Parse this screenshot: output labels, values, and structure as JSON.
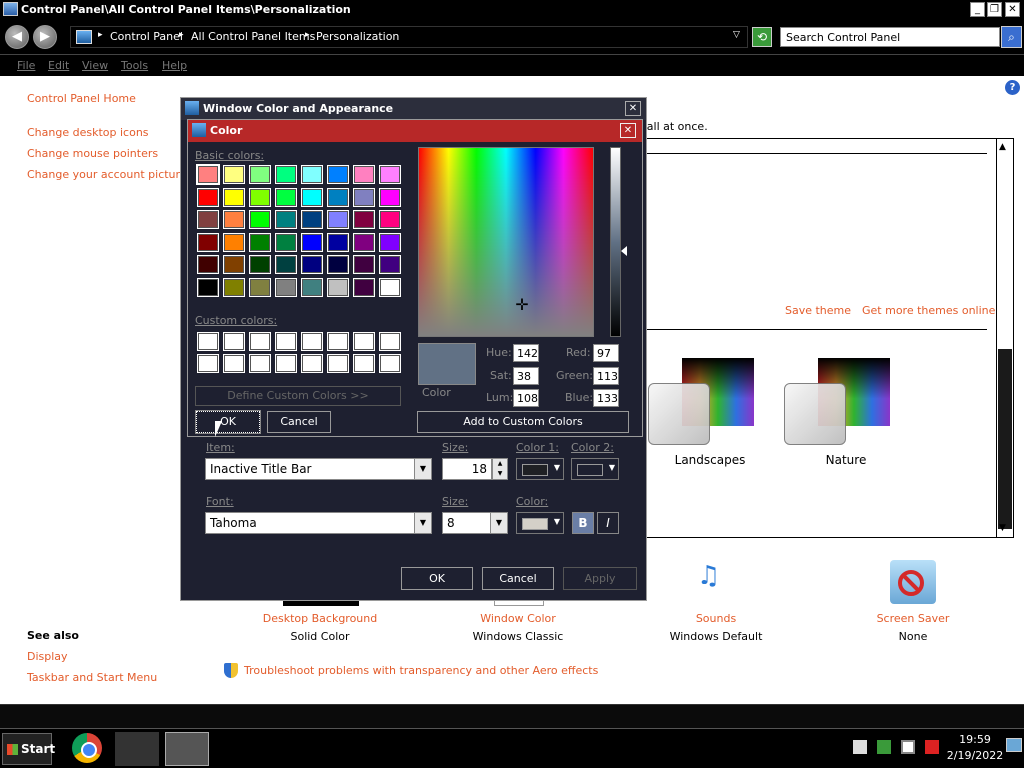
{
  "window": {
    "title": "Control Panel\\All Control Panel Items\\Personalization",
    "minimize_glyph": "_",
    "maximize_glyph": "❐",
    "close_glyph": "✕"
  },
  "address": {
    "back_glyph": "◀",
    "forward_glyph": "▶",
    "crumbs": [
      "Control Panel",
      "All Control Panel Items",
      "Personalization"
    ],
    "search_placeholder": "Search Control Panel"
  },
  "menu": [
    "File",
    "Edit",
    "View",
    "Tools",
    "Help"
  ],
  "sidebar": {
    "home": "Control Panel Home",
    "links": [
      "Change desktop icons",
      "Change mouse pointers",
      "Change your account picture"
    ],
    "see_also_title": "See also",
    "see_also": [
      "Display",
      "Taskbar and Start Menu"
    ]
  },
  "themes": {
    "description_fragment": "er all at once.",
    "save_theme": "Save theme",
    "get_more": "Get more themes online",
    "items": [
      "Landscapes",
      "Nature"
    ]
  },
  "bottom": [
    {
      "title": "Desktop Background",
      "sub": "Solid Color"
    },
    {
      "title": "Window Color",
      "sub": "Windows Classic"
    },
    {
      "title": "Sounds",
      "sub": "Windows Default"
    },
    {
      "title": "Screen Saver",
      "sub": "None"
    }
  ],
  "troubleshoot": "Troubleshoot problems with transparency and other Aero effects",
  "wca": {
    "title": "Window Color and Appearance",
    "item_label": "Item:",
    "item_value": "Inactive Title Bar",
    "size_label": "Size:",
    "item_size": "18",
    "color1_label": "Color 1:",
    "color2_label": "Color 2:",
    "color1": "#1f2024",
    "color2": "#1e2030",
    "font_label": "Font:",
    "font_value": "Tahoma",
    "font_size_label": "Size:",
    "font_size": "8",
    "font_color_label": "Color:",
    "font_color": "#d4d0c8",
    "bold_label": "B",
    "italic_label": "I",
    "ok": "OK",
    "cancel": "Cancel",
    "apply": "Apply"
  },
  "color_dialog": {
    "title": "Color",
    "basic_colors_label": "Basic colors:",
    "custom_colors_label": "Custom colors:",
    "basic_colors": [
      "#ff8080",
      "#ffff80",
      "#80ff80",
      "#00ff80",
      "#80ffff",
      "#0080ff",
      "#ff80c0",
      "#ff80ff",
      "#ff0000",
      "#ffff00",
      "#80ff00",
      "#00ff40",
      "#00ffff",
      "#0080c0",
      "#8080c0",
      "#ff00ff",
      "#804040",
      "#ff8040",
      "#00ff00",
      "#008080",
      "#004080",
      "#8080ff",
      "#800040",
      "#ff0080",
      "#800000",
      "#ff8000",
      "#008000",
      "#008040",
      "#0000ff",
      "#0000a0",
      "#800080",
      "#8000ff",
      "#400000",
      "#804000",
      "#004000",
      "#004040",
      "#000080",
      "#000040",
      "#400040",
      "#400080",
      "#000000",
      "#808000",
      "#808040",
      "#808080",
      "#408080",
      "#c0c0c0",
      "#400040",
      "#ffffff"
    ],
    "custom_colors": [
      "#ffffff",
      "#ffffff",
      "#ffffff",
      "#ffffff",
      "#ffffff",
      "#ffffff",
      "#ffffff",
      "#ffffff",
      "#ffffff",
      "#ffffff",
      "#ffffff",
      "#ffffff",
      "#ffffff",
      "#ffffff",
      "#ffffff",
      "#ffffff"
    ],
    "define_custom": "Define Custom Colors >>",
    "ok": "OK",
    "cancel": "Cancel",
    "add_custom": "Add to Custom Colors",
    "color_solid_label": "Color",
    "hue_label": "Hue:",
    "sat_label": "Sat:",
    "lum_label": "Lum:",
    "red_label": "Red:",
    "green_label": "Green:",
    "blue_label": "Blue:",
    "hue": "142",
    "sat": "38",
    "lum": "108",
    "red": "97",
    "green": "113",
    "blue": "133",
    "preview_color": "#617185"
  },
  "taskbar": {
    "start": "Start",
    "time": "19:59",
    "date": "2/19/2022"
  }
}
